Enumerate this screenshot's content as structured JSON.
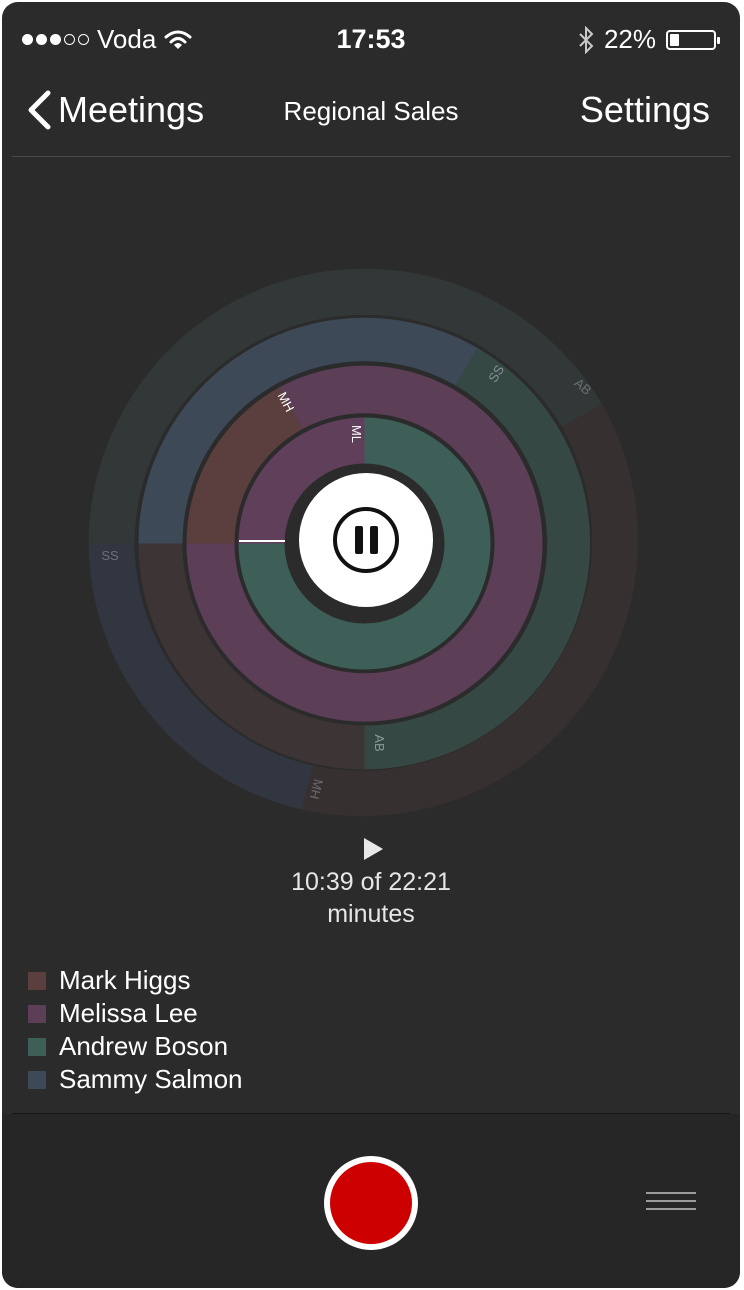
{
  "status_bar": {
    "carrier": "Voda",
    "signal": {
      "filled": 3,
      "total": 5
    },
    "time": "17:53",
    "battery_percent": "22%",
    "battery_level": 0.22,
    "icons": [
      "wifi-icon",
      "bluetooth-icon",
      "battery-icon"
    ]
  },
  "nav": {
    "back_label": "Meetings",
    "title": "Regional Sales",
    "settings_label": "Settings"
  },
  "chart": {
    "center_icon": "pause-icon",
    "rings": [
      {
        "segments": [
          {
            "label": "ML",
            "color": "#603f5a"
          },
          {
            "label": "",
            "color": "#3e5e58"
          }
        ]
      },
      {
        "segments": [
          {
            "label": "MH",
            "color": "#5a3f3e"
          },
          {
            "label": "",
            "color": "#5c3e56"
          }
        ]
      },
      {
        "segments": [
          {
            "label": "SS",
            "color": "#3e4958"
          },
          {
            "label": "",
            "color": "#354844"
          },
          {
            "label": "AB",
            "color": "#3a3637"
          },
          {
            "label": "",
            "color": "#3d3436"
          }
        ]
      },
      {
        "segments": [
          {
            "label": "AB",
            "color": "#323737"
          },
          {
            "label": "",
            "color": "#373031"
          },
          {
            "label": "MH",
            "color": "#313640"
          },
          {
            "label": "SS",
            "color": ""
          }
        ]
      }
    ]
  },
  "playback": {
    "play_icon": "play-icon",
    "line1": "10:39 of 22:21",
    "line2": "minutes"
  },
  "legend": [
    {
      "name": "Mark Higgs",
      "color": "#5a3f3e"
    },
    {
      "name": "Melissa Lee",
      "color": "#5c3e56"
    },
    {
      "name": "Andrew Boson",
      "color": "#3e5e58"
    },
    {
      "name": "Sammy Salmon",
      "color": "#3e4958"
    }
  ],
  "footer": {
    "record_icon": "record-icon",
    "menu_icon": "menu-icon",
    "record_color": "#cc0000"
  }
}
